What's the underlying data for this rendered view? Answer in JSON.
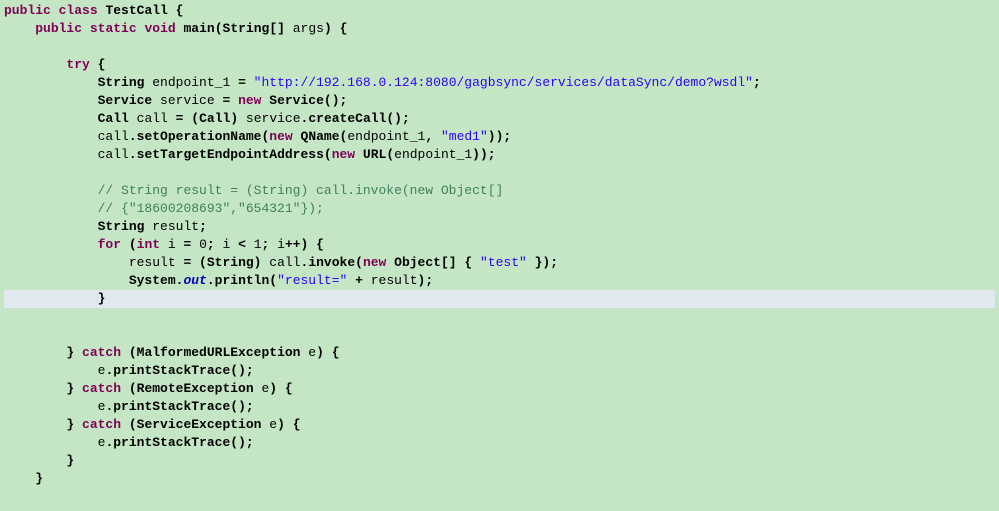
{
  "chart_data": {
    "type": "table",
    "title": "Java source snippet",
    "language": "Java",
    "lines": [
      "public class TestCall {",
      "    public static void main(String[] args) {",
      "",
      "        try {",
      "            String endpoint_1 = \"http://192.168.0.124:8080/gagbsync/services/dataSync/demo?wsdl\";",
      "            Service service = new Service();",
      "            Call call = (Call) service.createCall();",
      "            call.setOperationName(new QName(endpoint_1, \"med1\"));",
      "            call.setTargetEndpointAddress(new URL(endpoint_1));",
      "",
      "            // String result = (String) call.invoke(new Object[]",
      "            // {\"18600208693\",\"654321\"});",
      "            String result;",
      "            for (int i = 0; i < 1; i++) {",
      "                result = (String) call.invoke(new Object[] { \"test\" });",
      "                System.out.println(\"result=\" + result);",
      "            }",
      "",
      "        } catch (MalformedURLException e) {",
      "            e.printStackTrace();",
      "        } catch (RemoteException e) {",
      "            e.printStackTrace();",
      "        } catch (ServiceException e) {",
      "            e.printStackTrace();",
      "        }",
      "    }"
    ]
  },
  "t": {
    "public": "public",
    "class": "class",
    "TestCall": "TestCall",
    "static": "static",
    "void": "void",
    "main": "main",
    "String": "String",
    "args": "args",
    "try": "try",
    "endpoint_var": "endpoint_1",
    "endpoint_url": "\"http://192.168.0.124:8080/gagbsync/services/dataSync/demo?wsdl\"",
    "Service": "Service",
    "service": "service",
    "new": "new",
    "Call": "Call",
    "call": "call",
    "createCall": "createCall",
    "setOperationName": "setOperationName",
    "QName": "QName",
    "med1": "\"med1\"",
    "setTargetEndpointAddress": "setTargetEndpointAddress",
    "URL": "URL",
    "comment1": "// String result = (String) call.invoke(new Object[]",
    "comment2": "// {\"18600208693\",\"654321\"});",
    "result": "result",
    "for": "for",
    "int": "int",
    "i": "i",
    "zero": "0",
    "one": "1",
    "invoke": "invoke",
    "Object": "Object",
    "test": "\"test\"",
    "System": "System",
    "out": "out",
    "println": "println",
    "result_eq": "\"result=\"",
    "catch": "catch",
    "MalformedURLException": "MalformedURLException",
    "RemoteException": "RemoteException",
    "ServiceException": "ServiceException",
    "e": "e",
    "printStackTrace": "printStackTrace"
  }
}
